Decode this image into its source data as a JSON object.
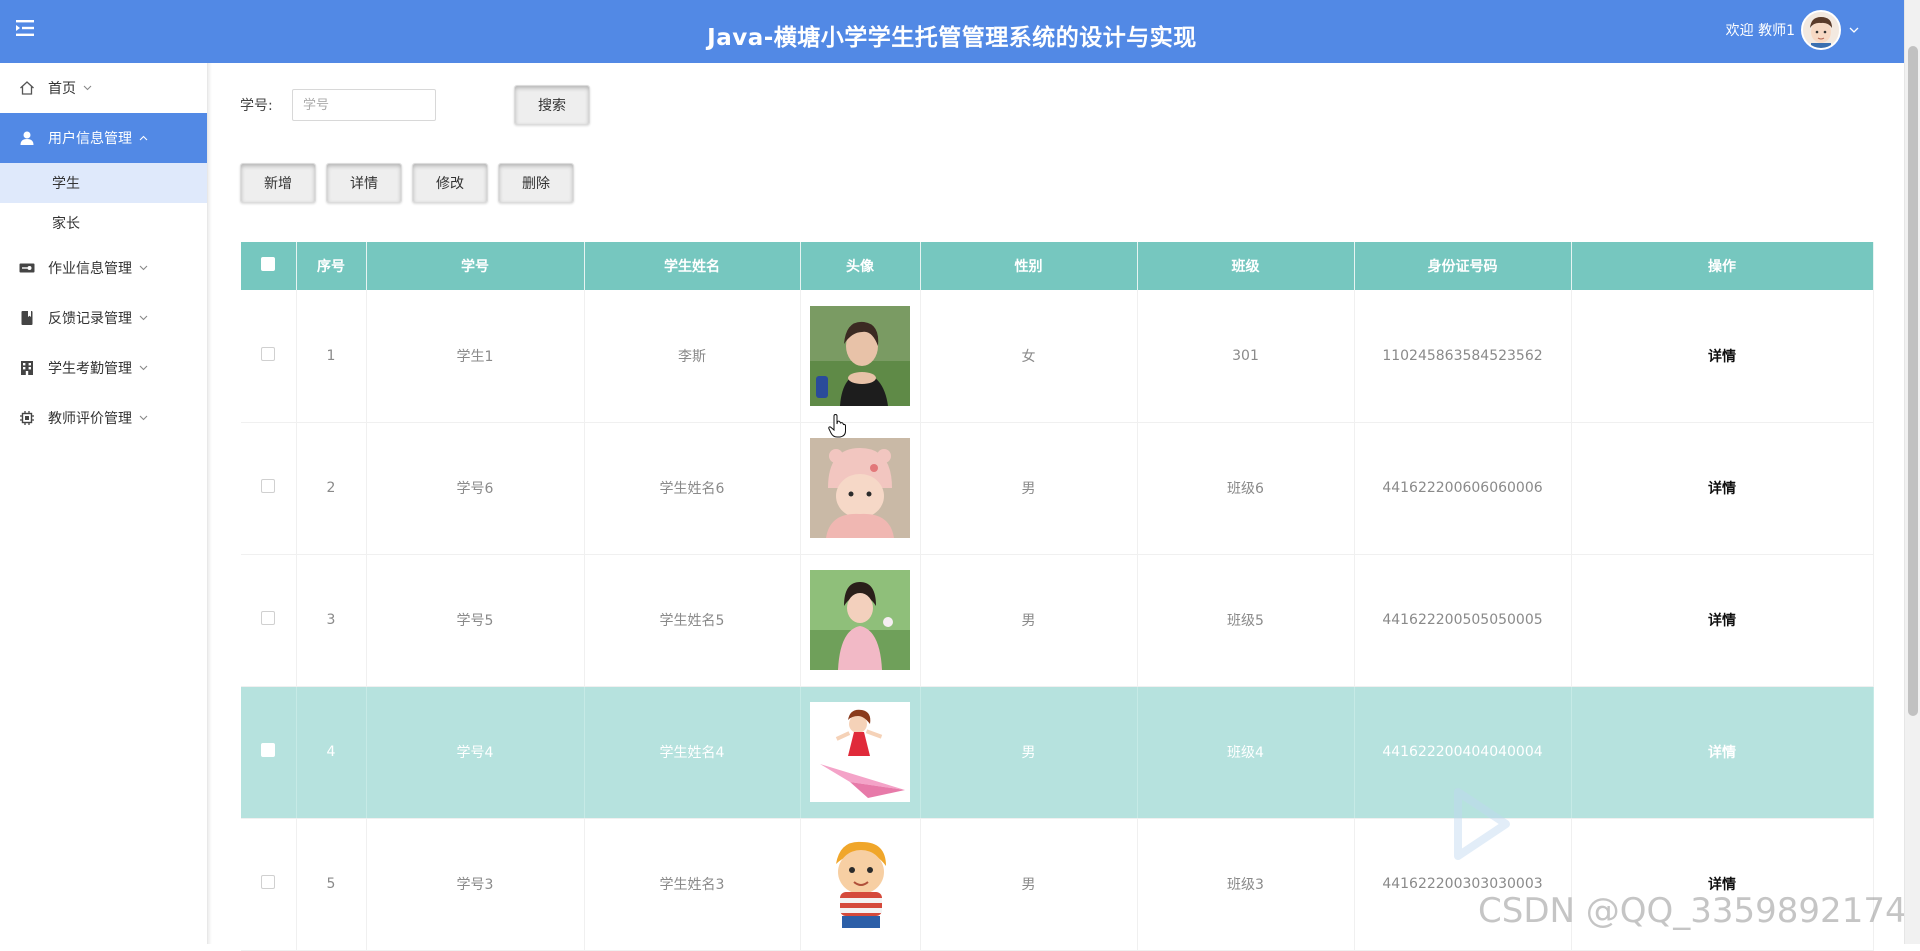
{
  "header": {
    "title": "Java-横塘小学学生托管管理系统的设计与实现",
    "welcome": "欢迎 教师1",
    "bg_color": "#5289e5"
  },
  "sidebar": {
    "items": [
      {
        "label": "首页",
        "icon": "home-icon"
      },
      {
        "label": "用户信息管理",
        "icon": "user-icon",
        "expanded": true,
        "children": [
          {
            "label": "学生",
            "active": true
          },
          {
            "label": "家长"
          }
        ]
      },
      {
        "label": "作业信息管理",
        "icon": "key-card-icon"
      },
      {
        "label": "反馈记录管理",
        "icon": "book-icon"
      },
      {
        "label": "学生考勤管理",
        "icon": "building-icon"
      },
      {
        "label": "教师评价管理",
        "icon": "chip-icon"
      }
    ]
  },
  "search": {
    "label": "学号:",
    "placeholder": "学号",
    "value": "",
    "button": "搜索"
  },
  "actions": {
    "add": "新增",
    "detail": "详情",
    "edit": "修改",
    "delete": "删除"
  },
  "table": {
    "header_color": "#76c7bf",
    "selected_color": "#b6e2de",
    "columns": [
      "序号",
      "学号",
      "学生姓名",
      "头像",
      "性别",
      "班级",
      "身份证号码",
      "操作"
    ],
    "rows": [
      {
        "index": "1",
        "student_id": "学生1",
        "name": "李斯",
        "gender": "女",
        "class": "301",
        "id_card": "110245863584523562",
        "op": "详情"
      },
      {
        "index": "2",
        "student_id": "学号6",
        "name": "学生姓名6",
        "gender": "男",
        "class": "班级6",
        "id_card": "441622200606060006",
        "op": "详情"
      },
      {
        "index": "3",
        "student_id": "学号5",
        "name": "学生姓名5",
        "gender": "男",
        "class": "班级5",
        "id_card": "441622200505050005",
        "op": "详情"
      },
      {
        "index": "4",
        "student_id": "学号4",
        "name": "学生姓名4",
        "gender": "男",
        "class": "班级4",
        "id_card": "441622200404040004",
        "op": "详情",
        "selected": true
      },
      {
        "index": "5",
        "student_id": "学号3",
        "name": "学生姓名3",
        "gender": "男",
        "class": "班级3",
        "id_card": "441622200303030003",
        "op": "详情"
      }
    ]
  },
  "overlay": {
    "csdn": "CSDN @QQ_3359892174"
  }
}
